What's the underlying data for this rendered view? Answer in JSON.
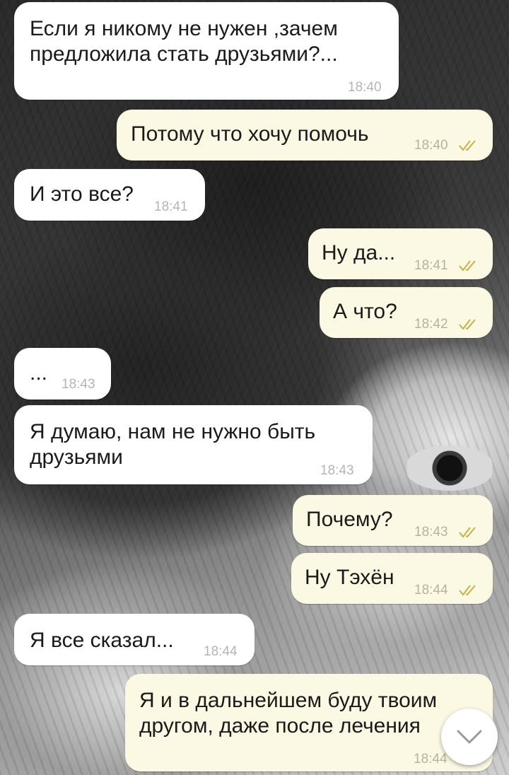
{
  "messages": [
    {
      "dir": "in",
      "text": "Если я никому не нужен ,зачем\nпредложила стать друзьями?...",
      "time": "18:40"
    },
    {
      "dir": "out",
      "text": "Потому что хочу помочь",
      "time": "18:40",
      "read": true
    },
    {
      "dir": "in",
      "text": "И это все?",
      "time": "18:41"
    },
    {
      "dir": "out",
      "text": "Ну да...",
      "time": "18:41",
      "read": true
    },
    {
      "dir": "out",
      "text": "А что?",
      "time": "18:42",
      "read": true
    },
    {
      "dir": "in",
      "text": "...",
      "time": "18:43"
    },
    {
      "dir": "in",
      "text": "Я думаю, нам не нужно быть\nдрузьями",
      "time": "18:43"
    },
    {
      "dir": "out",
      "text": "Почему?",
      "time": "18:43",
      "read": true
    },
    {
      "dir": "out",
      "text": "Ну Тэхён",
      "time": "18:44",
      "read": true
    },
    {
      "dir": "in",
      "text": "Я все сказал...",
      "time": "18:44"
    },
    {
      "dir": "out",
      "text": "Я и в дальнейшем буду твоим\nдругом, даже после лечения",
      "time": "18:44",
      "read": true
    }
  ],
  "icons": {
    "read_receipt": "double-check-icon",
    "scroll_down": "chevron-down-icon"
  },
  "colors": {
    "incoming_bubble": "#ffffff",
    "outgoing_bubble": "#fbf8e4",
    "tick": "#c7b24a"
  }
}
